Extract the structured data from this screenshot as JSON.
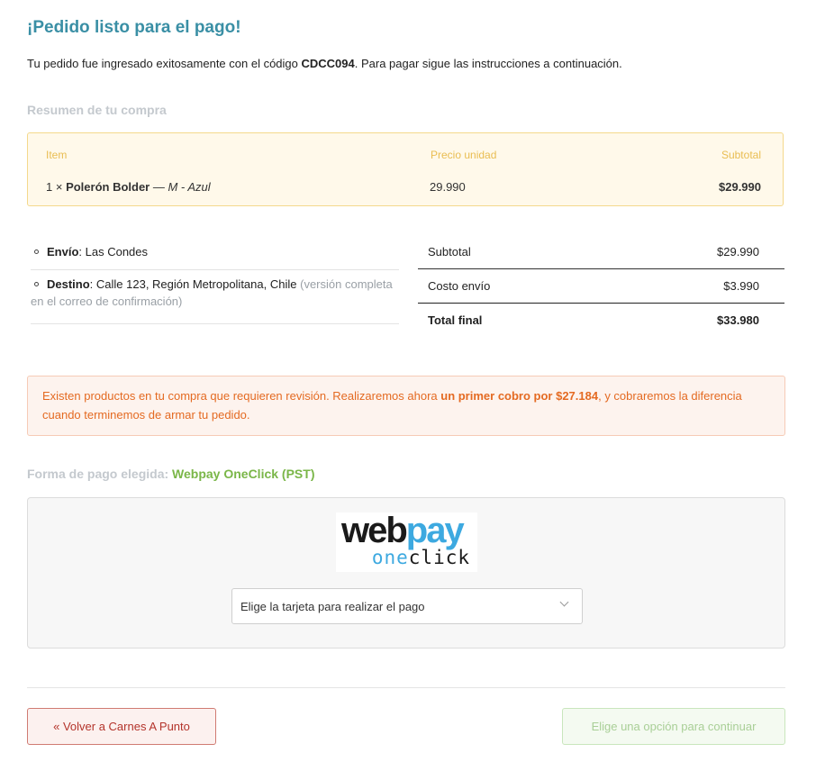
{
  "header": {
    "title": "¡Pedido listo para el pago!",
    "intro_prefix": "Tu pedido fue ingresado exitosamente con el código ",
    "order_code": "CDCC094",
    "intro_suffix": ". Para pagar sigue las instrucciones a continuación."
  },
  "summary": {
    "heading": "Resumen de tu compra",
    "columns": [
      "Item",
      "Precio unidad",
      "Subtotal"
    ],
    "items": [
      {
        "qty": "1 ×",
        "name": "Polerón Bolder",
        "variant": "— M - Azul",
        "unit_price": "29.990",
        "subtotal": "$29.990"
      }
    ]
  },
  "shipping": {
    "envio_label": "Envío",
    "envio_value": ": Las Condes",
    "destino_label": "Destino",
    "destino_value": ": Calle 123, Región Metropolitana, Chile",
    "destino_note": "(versión completa en el correo de confirmación)"
  },
  "totals": [
    {
      "label": "Subtotal",
      "value": "$29.990"
    },
    {
      "label": "Costo envío",
      "value": "$3.990"
    },
    {
      "label": "Total final",
      "value": "$33.980"
    }
  ],
  "alert": {
    "text_prefix": "Existen productos en tu compra que requieren revisión. Realizaremos ahora ",
    "text_bold": "un primer cobro por $27.184",
    "text_suffix": ", y cobraremos la diferencia cuando terminemos de armar tu pedido."
  },
  "payment": {
    "label": "Forma de pago elegida: ",
    "method": "Webpay OneClick (PST)",
    "logo_word_1": "web",
    "logo_word_2": "pay",
    "logo_sub_1": "one",
    "logo_sub_2": "click",
    "select_placeholder": "Elige la tarjeta para realizar el pago"
  },
  "actions": {
    "back_label": "« Volver a Carnes A Punto",
    "continue_label": "Elige una opción para continuar"
  },
  "colors": {
    "title": "#3a8fa5",
    "method_green": "#7ab648",
    "alert_orange": "#e46a22",
    "back_red": "#b4342b"
  }
}
